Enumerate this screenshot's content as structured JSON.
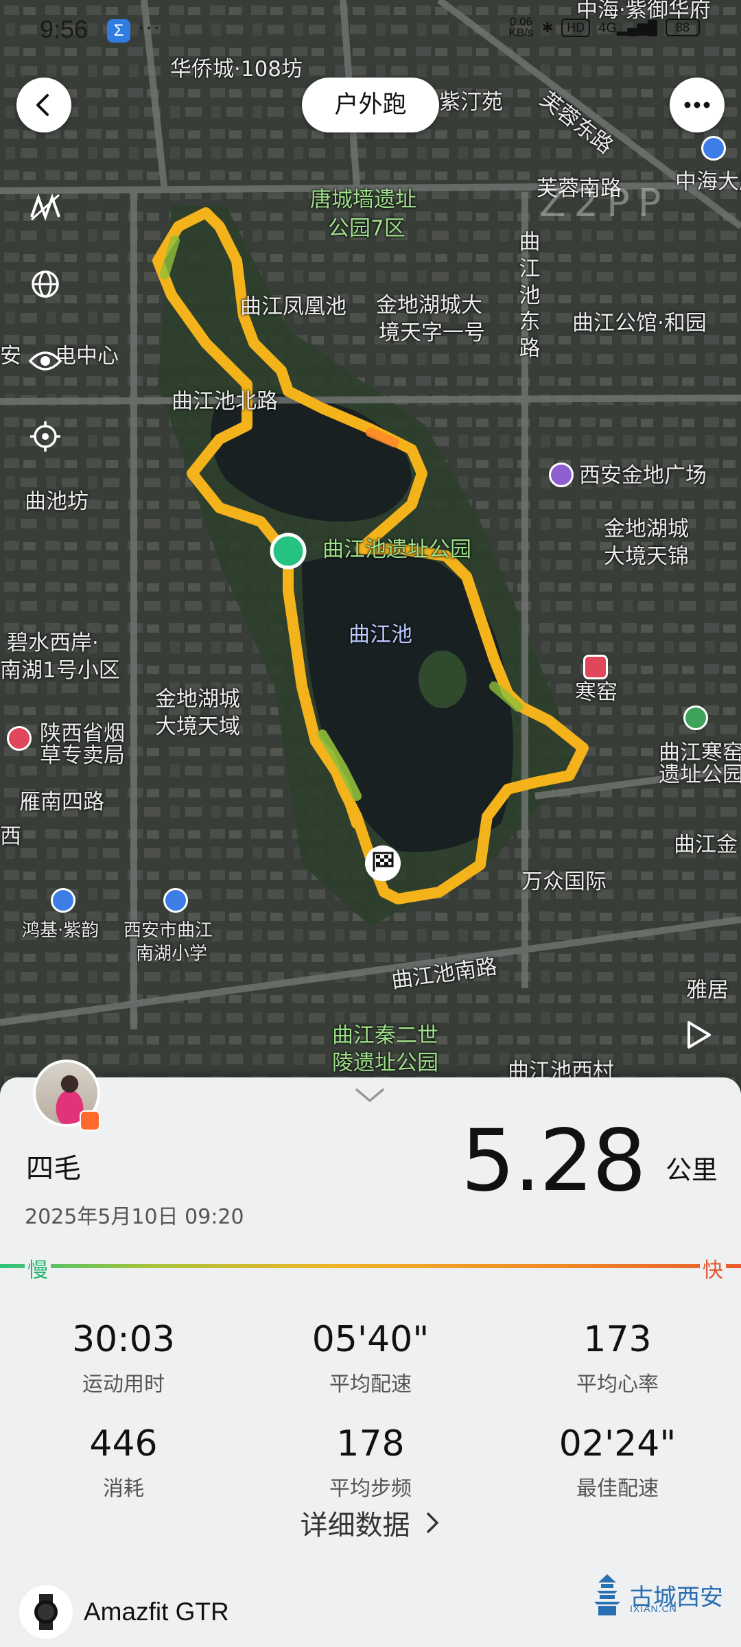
{
  "status_bar": {
    "time": "9:56",
    "app_icon": "Σ",
    "net_speed_value": "0.06",
    "net_speed_unit": "KB/s",
    "hd_label": "HD",
    "network_label": "4G",
    "battery": "88"
  },
  "header": {
    "title": "户外跑",
    "back_icon": "chevron-left-icon",
    "more_icon": "more-dots-icon"
  },
  "map": {
    "labels": [
      {
        "text": "华侨城·108坊",
        "style": ""
      },
      {
        "text": "紫汀苑",
        "style": ""
      },
      {
        "text": "中海·紫御华府",
        "style": ""
      },
      {
        "text": "芙蓉东路",
        "style": ""
      },
      {
        "text": "芙蓉南路",
        "style": ""
      },
      {
        "text": "中海大厦",
        "style": ""
      },
      {
        "text": "唐城墙遗址",
        "style": "green"
      },
      {
        "text": "公园7区",
        "style": "green"
      },
      {
        "text": "曲江凤凰池",
        "style": ""
      },
      {
        "text": "金地湖城大",
        "style": ""
      },
      {
        "text": "境天字一号",
        "style": ""
      },
      {
        "text": "曲江池东路",
        "style": "vert"
      },
      {
        "text": "曲江公馆·和园",
        "style": ""
      },
      {
        "text": "安",
        "style": ""
      },
      {
        "text": "电中心",
        "style": ""
      },
      {
        "text": "曲江池北路",
        "style": ""
      },
      {
        "text": "西安金地广场",
        "style": ""
      },
      {
        "text": "曲池坊",
        "style": ""
      },
      {
        "text": "曲江池遗址公园",
        "style": "green"
      },
      {
        "text": "金地湖城",
        "style": ""
      },
      {
        "text": "大境天锦",
        "style": ""
      },
      {
        "text": "曲江池",
        "style": "blue"
      },
      {
        "text": "碧水西岸·",
        "style": ""
      },
      {
        "text": "南湖1号小区",
        "style": ""
      },
      {
        "text": "寒窑",
        "style": ""
      },
      {
        "text": "金地湖城",
        "style": ""
      },
      {
        "text": "大境天域",
        "style": ""
      },
      {
        "text": "陕西省烟",
        "style": ""
      },
      {
        "text": "草专卖局",
        "style": ""
      },
      {
        "text": "曲江寒窑",
        "style": ""
      },
      {
        "text": "遗址公园",
        "style": ""
      },
      {
        "text": "雁南四路",
        "style": ""
      },
      {
        "text": "西",
        "style": ""
      },
      {
        "text": "曲江金",
        "style": ""
      },
      {
        "text": "万众国际",
        "style": ""
      },
      {
        "text": "鸿基·紫韵",
        "style": ""
      },
      {
        "text": "西安市曲江",
        "style": ""
      },
      {
        "text": "南湖小学",
        "style": ""
      },
      {
        "text": "曲江池南路",
        "style": ""
      },
      {
        "text": "雅居",
        "style": ""
      },
      {
        "text": "曲江秦二世",
        "style": "green"
      },
      {
        "text": "陵遗址公园",
        "style": "green"
      },
      {
        "text": "曲江池西村",
        "style": ""
      },
      {
        "text": "Z2PP",
        "style": ""
      }
    ],
    "tools": [
      "km-marker-icon",
      "globe-icon",
      "eye-icon",
      "locate-icon"
    ],
    "play_icon": "play-icon",
    "route_color": "#f4b21b",
    "start_color": "#26c281"
  },
  "summary": {
    "user_name": "四毛",
    "date": "2025年5月10日 09:20",
    "distance": "5.28",
    "distance_unit": "公里",
    "pace_slow": "慢",
    "pace_fast": "快",
    "stats": [
      {
        "value": "30:03",
        "label": "运动用时"
      },
      {
        "value": "05'40\"",
        "label": "平均配速"
      },
      {
        "value": "173",
        "label": "平均心率"
      },
      {
        "value": "446",
        "label": "消耗"
      },
      {
        "value": "178",
        "label": "平均步频"
      },
      {
        "value": "02'24\"",
        "label": "最佳配速"
      }
    ],
    "detail_link": "详细数据",
    "device_name": "Amazfit GTR"
  },
  "watermark": {
    "text": "古城西安",
    "url": "IXIAN.CN"
  },
  "colors": {
    "pace_slow": "#27b56f",
    "pace_fast": "#e7552d",
    "panel_bg": "#eef0f2"
  }
}
